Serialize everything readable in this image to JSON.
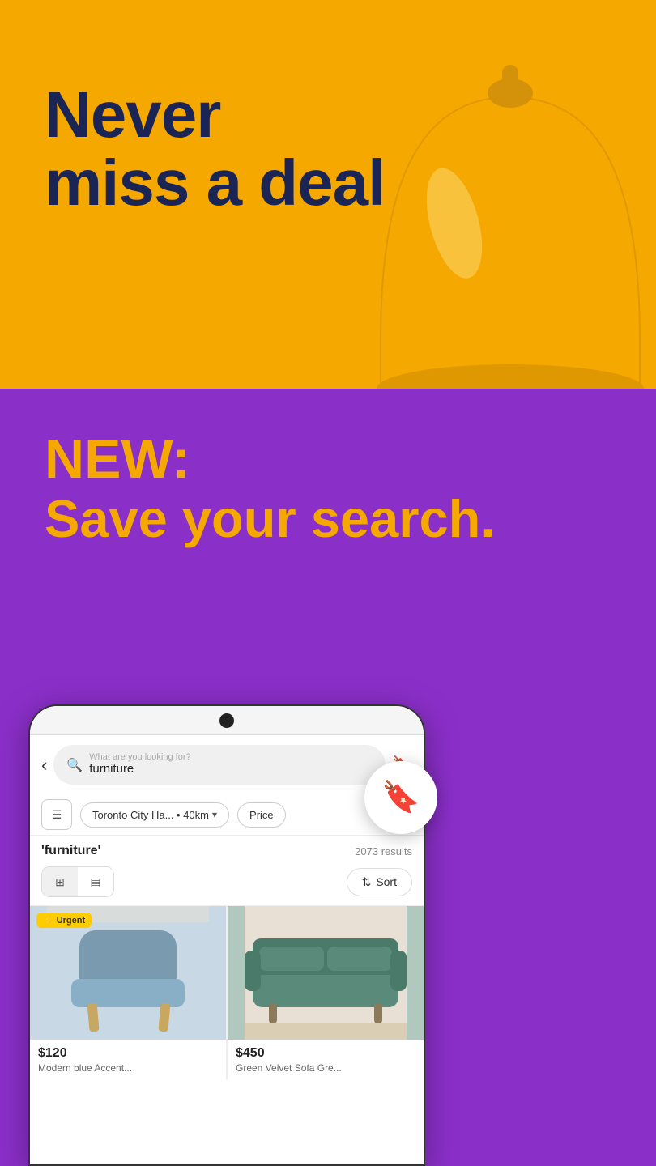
{
  "hero": {
    "title_line1": "Never",
    "title_line2": "miss a deal",
    "yellow_bg": "#F5A800",
    "purple_bg": "#8B2FC9",
    "new_label": "NEW:",
    "save_search_label": "Save your search."
  },
  "phone": {
    "search_placeholder": "What are you looking for?",
    "search_value": "furniture",
    "location": "Toronto City Ha... • 40km",
    "price_label": "Price",
    "results_query": "'furniture'",
    "results_count": "2073 results",
    "sort_label": "Sort",
    "view_grid_label": "Grid view",
    "view_list_label": "List view"
  },
  "listings": [
    {
      "price": "$120",
      "name": "Modern blue Accent...",
      "urgent": true,
      "color": "#89afc7"
    },
    {
      "price": "$450",
      "name": "Green Velvet Sofa Gre...",
      "urgent": false,
      "color": "#5a8a7a"
    }
  ]
}
